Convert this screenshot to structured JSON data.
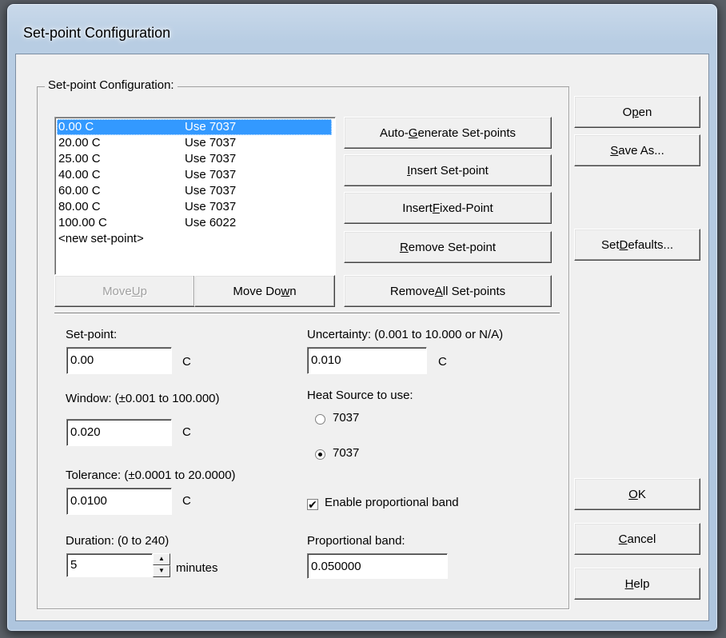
{
  "window": {
    "title": "Set-point Configuration"
  },
  "group": {
    "label": "Set-point Configuration:"
  },
  "setpoints": [
    {
      "temp": "0.00 C",
      "source": "Use 7037"
    },
    {
      "temp": "20.00 C",
      "source": "Use 7037"
    },
    {
      "temp": "25.00 C",
      "source": "Use 7037"
    },
    {
      "temp": "40.00 C",
      "source": "Use 7037"
    },
    {
      "temp": "60.00 C",
      "source": "Use 7037"
    },
    {
      "temp": "80.00 C",
      "source": "Use 7037"
    },
    {
      "temp": "100.00 C",
      "source": "Use 6022"
    }
  ],
  "new_setpoint": "<new set-point>",
  "buttons": {
    "move_up": {
      "pre": "Move ",
      "key": "U",
      "post": "p"
    },
    "move_down": {
      "pre": "Move Do",
      "key": "w",
      "post": "n"
    },
    "auto_generate": {
      "pre": "Auto-",
      "key": "G",
      "post": "enerate Set-points"
    },
    "insert_setpoint": {
      "pre": "",
      "key": "I",
      "post": "nsert Set-point"
    },
    "insert_fixed": {
      "pre": "Insert ",
      "key": "F",
      "post": "ixed-Point"
    },
    "remove_setpoint": {
      "pre": "",
      "key": "R",
      "post": "emove Set-point"
    },
    "remove_all": {
      "pre": "Remove ",
      "key": "A",
      "post": "ll Set-points"
    },
    "open": {
      "pre": "O",
      "key": "p",
      "post": "en"
    },
    "save_as": {
      "pre": "",
      "key": "S",
      "post": "ave As..."
    },
    "set_defaults": {
      "pre": "Set ",
      "key": "D",
      "post": "efaults..."
    },
    "ok": {
      "pre": "",
      "key": "O",
      "post": "K"
    },
    "cancel": {
      "pre": "",
      "key": "C",
      "post": "ancel"
    },
    "help": {
      "pre": "",
      "key": "H",
      "post": "elp"
    }
  },
  "fields": {
    "setpoint": {
      "label": "Set-point:",
      "value": "0.00",
      "unit": "C"
    },
    "window": {
      "label": "Window: (±0.001 to 100.000)",
      "value": "0.020",
      "unit": "C"
    },
    "tolerance": {
      "label": "Tolerance: (±0.0001 to 20.0000)",
      "value": "0.0100",
      "unit": "C"
    },
    "duration": {
      "label": "Duration: (0 to 240)",
      "value": "5",
      "unit": "minutes"
    },
    "uncertainty": {
      "label": "Uncertainty: (0.001 to 10.000 or N/A)",
      "value": "0.010",
      "unit": "C"
    },
    "heat_source": {
      "label": "Heat Source to use:",
      "options": [
        {
          "label": "7037",
          "selected": false
        },
        {
          "label": "7037",
          "selected": true
        }
      ]
    },
    "prop_band_enable": {
      "label": "Enable proportional band",
      "checked": true,
      "mark": "✔"
    },
    "prop_band": {
      "label": "Proportional band:",
      "value": "0.050000"
    }
  },
  "spinner": {
    "up": "▲",
    "down": "▼"
  }
}
